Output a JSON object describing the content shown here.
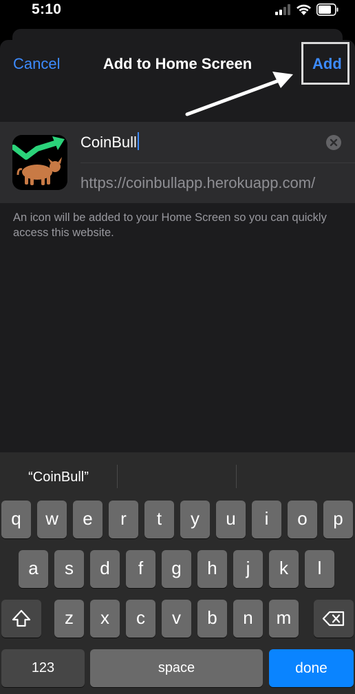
{
  "status": {
    "time": "5:10"
  },
  "nav": {
    "cancel": "Cancel",
    "title": "Add to Home Screen",
    "add": "Add"
  },
  "bookmark": {
    "name": "CoinBull",
    "url": "https://coinbullapp.herokuapp.com/",
    "note": "An icon will be added to your Home Screen so you can quickly access this website."
  },
  "keyboard": {
    "suggestion": "“CoinBull”",
    "row1": [
      "q",
      "w",
      "e",
      "r",
      "t",
      "y",
      "u",
      "i",
      "o",
      "p"
    ],
    "row2": [
      "a",
      "s",
      "d",
      "f",
      "g",
      "h",
      "j",
      "k",
      "l"
    ],
    "row3": [
      "z",
      "x",
      "c",
      "v",
      "b",
      "n",
      "m"
    ],
    "numbers": "123",
    "space": "space",
    "done": "done"
  },
  "colors": {
    "accent": "#3d8bff",
    "done_key": "#0a84ff",
    "sheet": "#1c1c1e"
  }
}
